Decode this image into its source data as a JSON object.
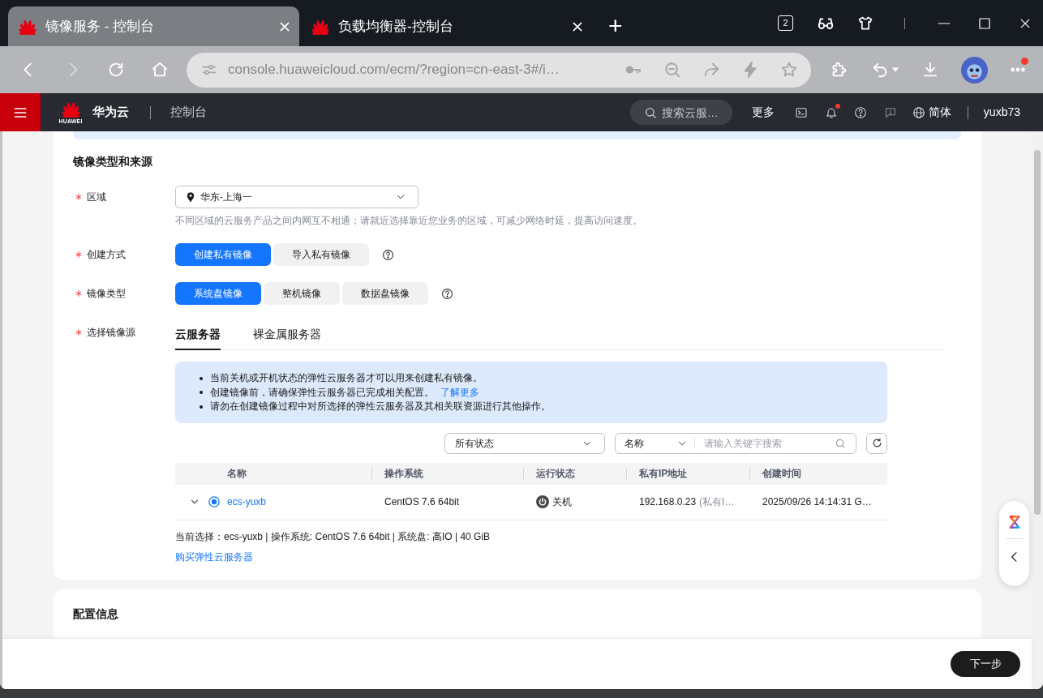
{
  "browser": {
    "tabs": [
      {
        "title": "镜像服务 - 控制台",
        "selected": true
      },
      {
        "title": "负载均衡器-控制台",
        "selected": false
      }
    ],
    "new_tab": "+",
    "tab_count": "2",
    "address": "console.huaweicloud.com/ecm/?region=cn-east-3#/i…",
    "forward_disabled": true,
    "menu_dot": true
  },
  "console_header": {
    "logo_text": "HUAWEI",
    "brand": "华为云",
    "section": "控制台",
    "search": {
      "placeholder": "搜索云服…"
    },
    "more": "更多",
    "notification_dot": true,
    "feedback_disabled": true,
    "language": "简体",
    "user": "yuxb73"
  },
  "image_source_card": {
    "title": "镜像类型和来源",
    "fields": [
      {
        "kind": "select",
        "label": "区域",
        "required": true,
        "value": "华东-上海一",
        "hint": "不同区域的云服务产品之间内网互不相通；请就近选择靠近您业务的区域，可减少网络时延，提高访问速度。"
      },
      {
        "kind": "buttons",
        "label": "创建方式",
        "required": true,
        "help": true,
        "options": [
          {
            "label": "创建私有镜像",
            "selected": true
          },
          {
            "label": "导入私有镜像",
            "selected": false
          }
        ]
      },
      {
        "kind": "buttons",
        "label": "镜像类型",
        "required": true,
        "help": true,
        "options": [
          {
            "label": "系统盘镜像",
            "selected": true
          },
          {
            "label": "整机镜像",
            "selected": false
          },
          {
            "label": "数据盘镜像",
            "selected": false
          }
        ]
      },
      {
        "kind": "tabs",
        "label": "选择镜像源",
        "required": true,
        "options": [
          {
            "label": "云服务器",
            "selected": true
          },
          {
            "label": "裸金属服务器",
            "selected": false
          }
        ]
      }
    ],
    "server_panel": {
      "notices": [
        {
          "text": "当前关机或开机状态的弹性云服务器才可以用来创建私有镜像。"
        },
        {
          "text": "创建镜像前，请确保弹性云服务器已完成相关配置。",
          "link": "了解更多"
        },
        {
          "text": "请勿在创建镜像过程中对所选择的弹性云服务器及其相关联资源进行其他操作。"
        }
      ],
      "status_filter": "所有状态",
      "search": {
        "field": "名称",
        "placeholder": "请输入关键字搜索"
      },
      "table": {
        "columns": [
          "名称",
          "操作系统",
          "运行状态",
          "私有IP地址",
          "创建时间"
        ],
        "rows": [
          {
            "expanded": false,
            "selected": true,
            "name": "ecs-yuxb",
            "os": "CentOS 7.6 64bit",
            "status": "关机",
            "ip": "192.168.0.23",
            "ip_note": "(私有I…",
            "created": "2025/09/26 14:14:31 G…"
          }
        ]
      },
      "summary": "当前选择：ecs-yuxb | 操作系统: CentOS 7.6 64bit | 系统盘: 高IO | 40 GiB",
      "buy_link": "购买弹性云服务器"
    }
  },
  "config_card": {
    "title": "配置信息"
  },
  "footer": {
    "next_button": "下一步"
  }
}
